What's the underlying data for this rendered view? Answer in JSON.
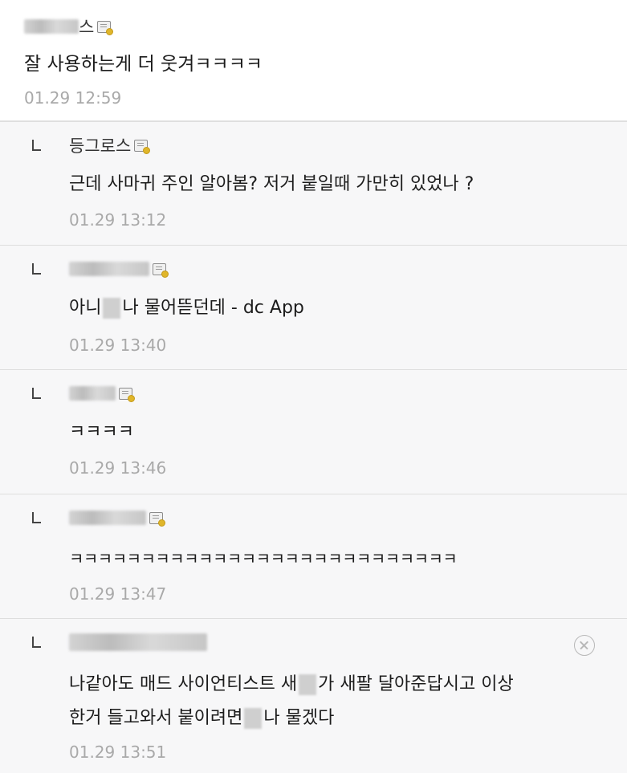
{
  "comment": {
    "author_suffix": "스",
    "body": "잘 사용하는게 더 웃겨ㅋㅋㅋㅋ",
    "time": "01.29 12:59"
  },
  "replies": [
    {
      "author": "등그로스",
      "body": "근데 사마귀 주인 알아봄? 저거 붙일때 가만히 있었나 ?",
      "time": "01.29 13:12"
    },
    {
      "body_pre": "아니",
      "body_post": "나 물어뜯던데 - dc App",
      "time": "01.29 13:40"
    },
    {
      "body": "ㅋㅋㅋㅋ",
      "time": "01.29 13:46"
    },
    {
      "body": "ㅋㅋㅋㅋㅋㅋㅋㅋㅋㅋㅋㅋㅋㅋㅋㅋㅋㅋㅋㅋㅋㅋㅋㅋㅋㅋㅋ",
      "time": "01.29 13:47"
    },
    {
      "line1_pre": "나같아도 매드 사이언티스트 새",
      "line1_post": "가 새팔 달아준답시고 이상",
      "line2_pre": "한거 들고와서 붙이려면",
      "line2_post": "나 물겠다",
      "time": "01.29 13:51"
    }
  ],
  "icons": {
    "memo": "memo-icon",
    "reply_arrow": "reply-arrow-icon",
    "delete": "close-icon"
  }
}
